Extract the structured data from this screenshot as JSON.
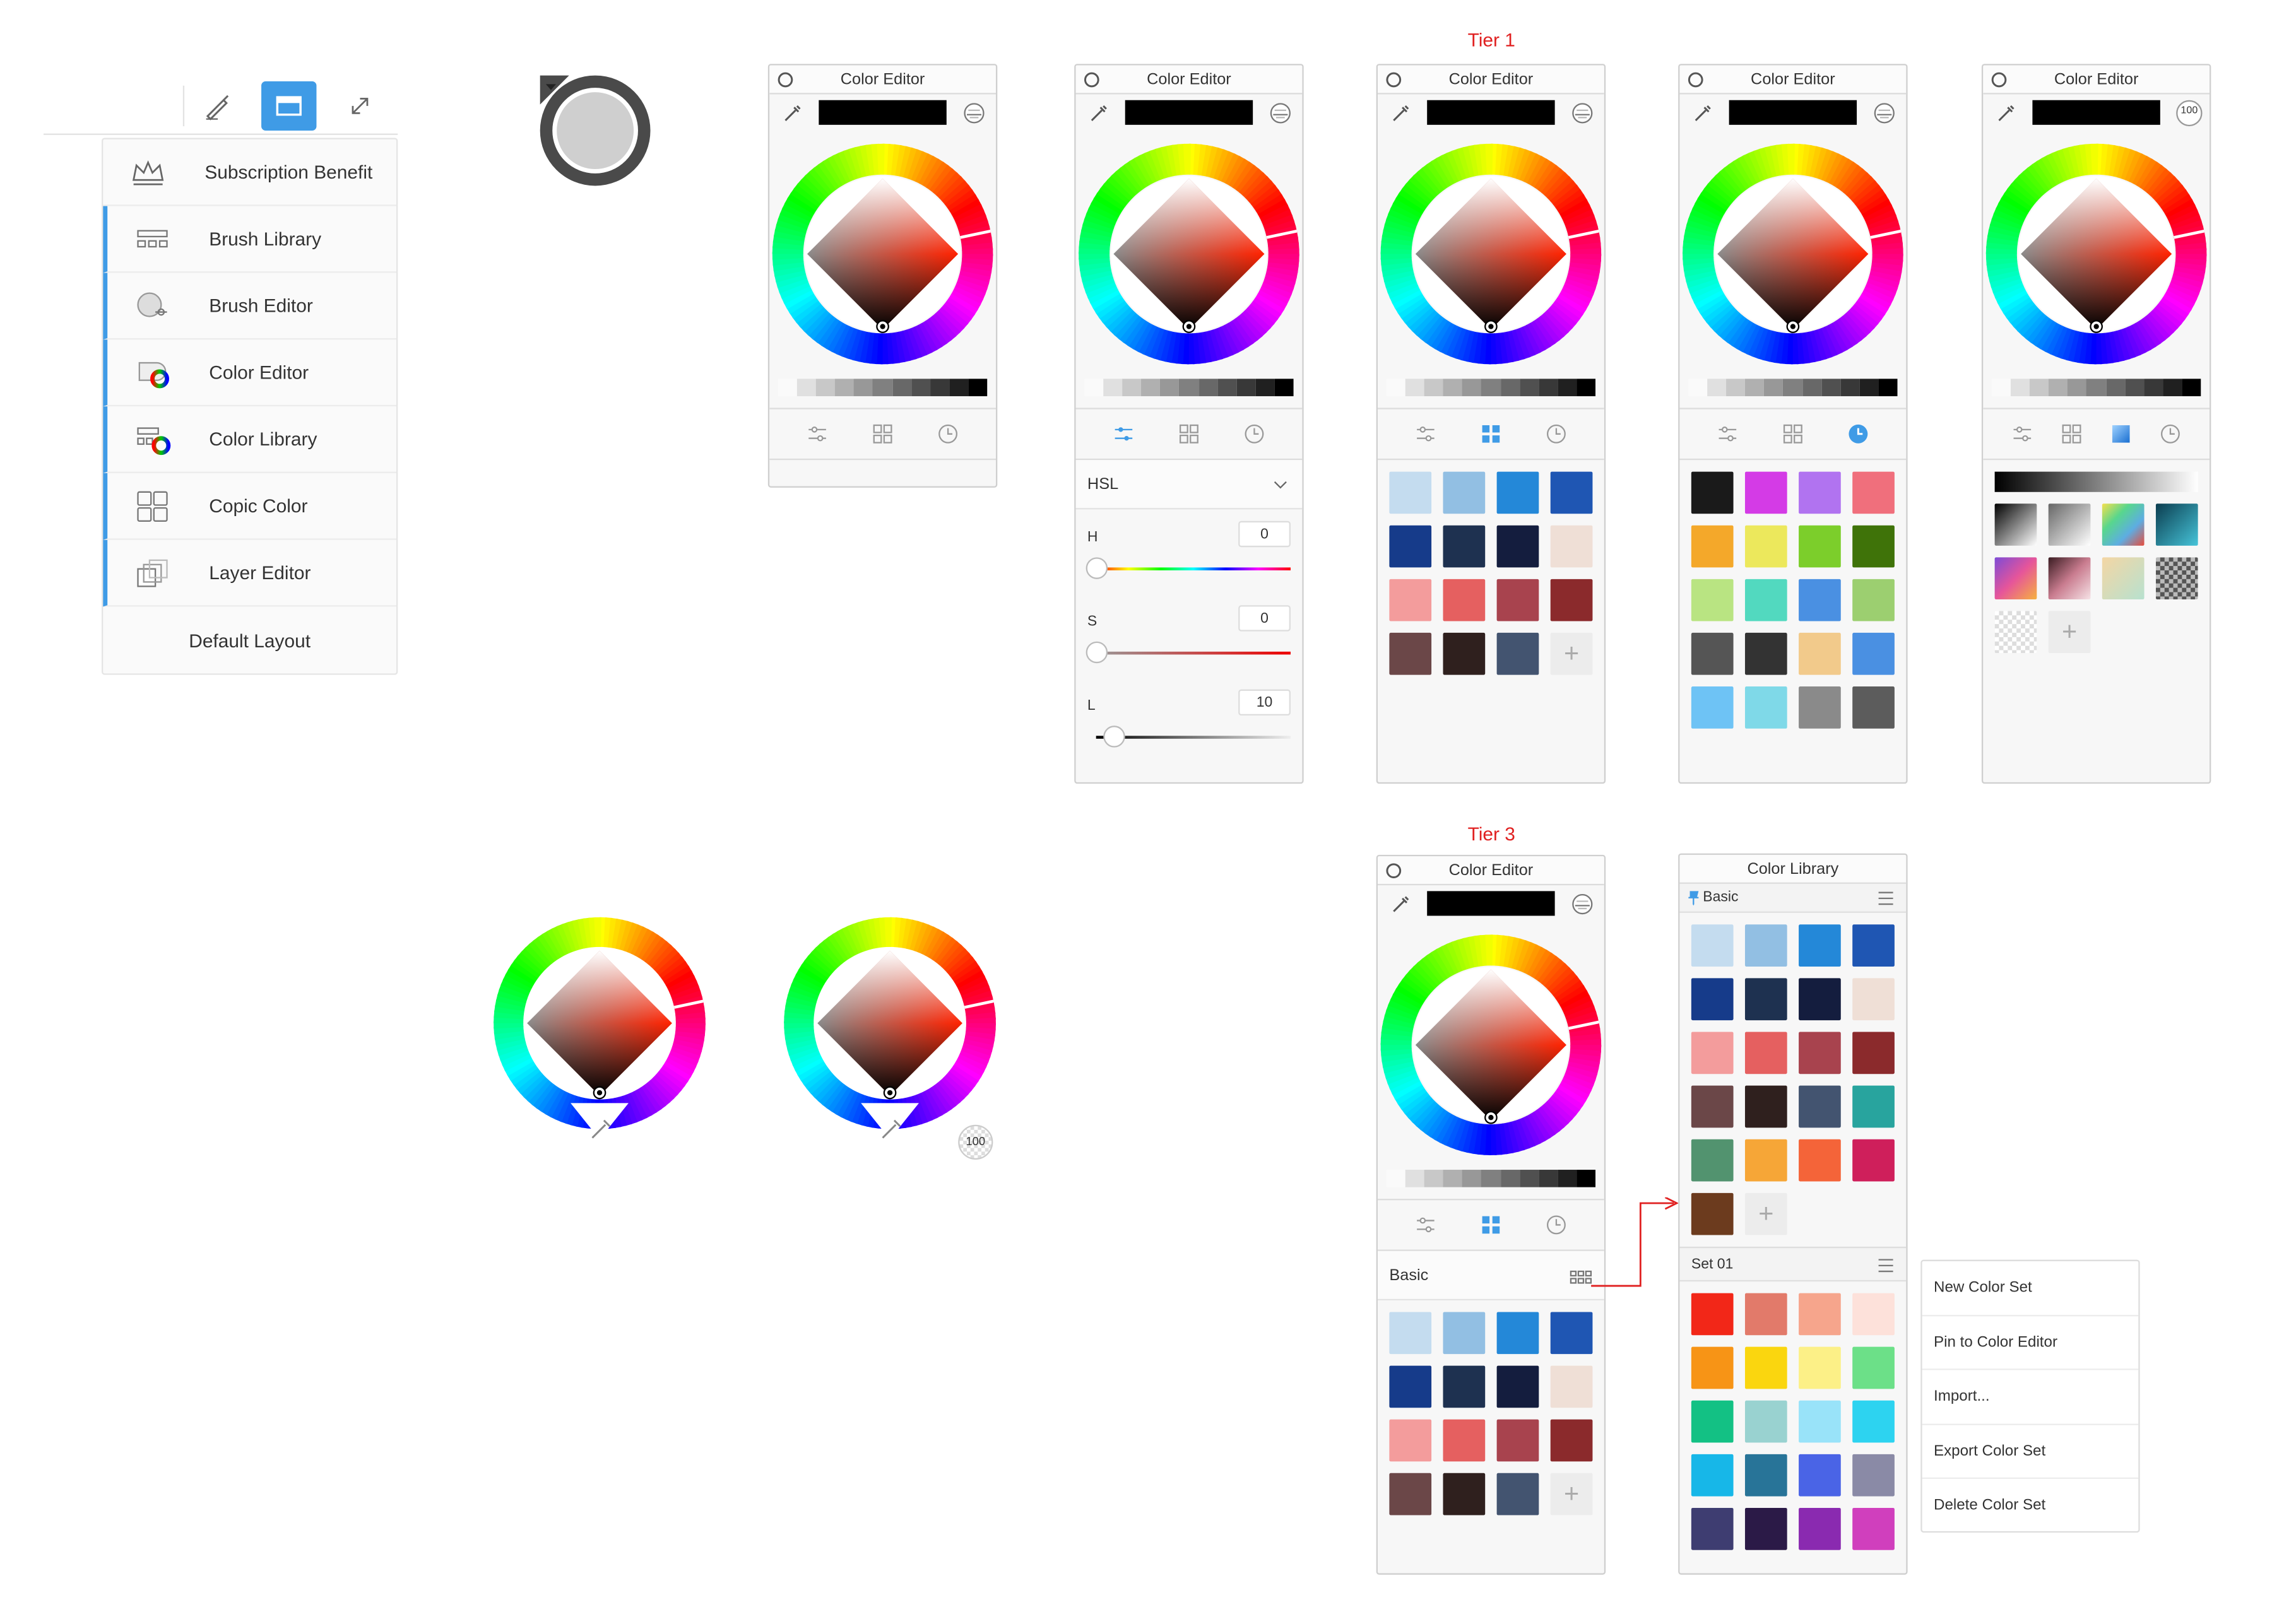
{
  "labels": {
    "tier1": "Tier 1",
    "tier3": "Tier 3"
  },
  "menu": {
    "items": [
      {
        "label": "Subscription Benefit",
        "icon": "crown-icon",
        "selected": false
      },
      {
        "label": "Brush Library",
        "icon": "brush-library-icon",
        "selected": true
      },
      {
        "label": "Brush Editor",
        "icon": "brush-editor-icon",
        "selected": true
      },
      {
        "label": "Color Editor",
        "icon": "color-editor-icon",
        "selected": true
      },
      {
        "label": "Color Library",
        "icon": "color-library-icon",
        "selected": true
      },
      {
        "label": "Copic Color",
        "icon": "copic-color-icon",
        "selected": true
      },
      {
        "label": "Layer Editor",
        "icon": "layer-editor-icon",
        "selected": true
      }
    ],
    "default_layout": "Default Layout"
  },
  "panels": {
    "p1_title": "Color Editor",
    "p2_title": "Color Editor",
    "p3_title": "Color Editor",
    "p4_title": "Color Editor",
    "p5_title": "Color Editor",
    "p6_title": "Color Editor",
    "lib_title": "Color Library",
    "opacity_badge": "100",
    "puck_badge": "100"
  },
  "hsl": {
    "mode": "HSL",
    "h_label": "H",
    "h_value": "0",
    "s_label": "S",
    "s_value": "0",
    "l_label": "L",
    "l_value": "10"
  },
  "basic_label": "Basic",
  "lib": {
    "basic": "Basic",
    "set01": "Set 01"
  },
  "context_menu": [
    "New Color Set",
    "Pin to Color Editor",
    "Import...",
    "Export Color Set",
    "Delete Color Set"
  ],
  "colors": {
    "accent": "#3f9be6",
    "basic_set": [
      "#c4dcef",
      "#92bfe3",
      "#2488d8",
      "#1f56b3",
      "#163b8a",
      "#1e3150",
      "#141d3e",
      "#efdfd6",
      "#f39c9c",
      "#e56060",
      "#a8434e",
      "#8b2a2c",
      "#6b4748",
      "#2f201e",
      "#435470"
    ],
    "lib_basic_extra": [
      "#28a49e",
      "#52936f",
      "#f6a637",
      "#f46439",
      "#cf1f5b",
      "#6c3b1e"
    ],
    "recent": [
      "#1a1a1a",
      "#d43be6",
      "#b173f0",
      "#f06f7c",
      "#f4a82a",
      "#ece85c",
      "#7cce2b",
      "#3f7309",
      "#b9e482",
      "#52d9bf",
      "#4a90e2",
      "#9ccf70",
      "#555555",
      "#333333",
      "#f2ca8b",
      "#4a90e2",
      "#6ec3f5",
      "#7fd9e8",
      "#8a8a8a",
      "#5c5c5c"
    ],
    "set01": [
      "#f22718",
      "#e27a6a",
      "#f6a58c",
      "#fde1da",
      "#f79416",
      "#fad60f",
      "#fcf087",
      "#6ce088",
      "#13c184",
      "#99d2d0",
      "#99e3f9",
      "#2dd3f0",
      "#17b7e8",
      "#287498",
      "#4a64e6",
      "#8a8aa6",
      "#3e3d71",
      "#2b1a47",
      "#8a2ab0",
      "#d03fbd"
    ]
  }
}
